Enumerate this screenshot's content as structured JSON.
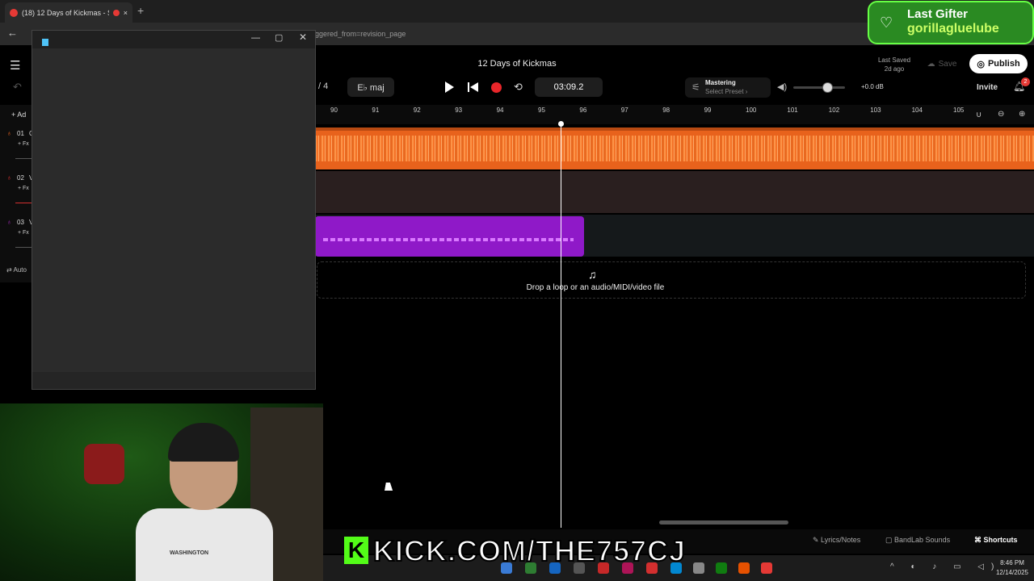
{
  "browser": {
    "tab_title": "(18) 12 Days of Kickmas - S",
    "tab_close": "×",
    "new_tab": "+",
    "back": "←",
    "url_fragment": "ggered_from=revision_page"
  },
  "header": {
    "menu_icon": "☰",
    "song_title": "12 Days of Kickmas",
    "last_saved_label": "Last Saved",
    "last_saved_value": "2d ago",
    "save_label": "Save",
    "publish_label": "Publish",
    "invite_label": "Invite",
    "notification_count": "2"
  },
  "transport": {
    "time_sig_fragment": "/ 4",
    "key": "E♭ maj",
    "time": "03:09.2",
    "loop_icon": "⟲"
  },
  "mastering": {
    "label": "Mastering",
    "preset": "Select Preset ›",
    "icon": "⚟"
  },
  "volume": {
    "db": "+0.0 dB",
    "level": 0.66
  },
  "gifter": {
    "title": "Last Gifter",
    "name": "gorillagluelube"
  },
  "tracks": {
    "add_label": "+ Ad",
    "items": [
      {
        "num": "01",
        "letter": "C",
        "fx": "+ Fx",
        "color": "#e8621c"
      },
      {
        "num": "02",
        "letter": "V",
        "fx": "+ Fx",
        "color": "#d32f2f"
      },
      {
        "num": "03",
        "letter": "V",
        "fx": "+ Fx",
        "color": "#9c27b0"
      }
    ],
    "automation_label": "Auto"
  },
  "ruler": {
    "ticks": [
      "90",
      "91",
      "92",
      "93",
      "94",
      "95",
      "96",
      "97",
      "98",
      "99",
      "100",
      "101",
      "102",
      "103",
      "104",
      "105"
    ]
  },
  "dropzone": {
    "text": "Drop a loop or an audio/MIDI/video file",
    "icon": "♫"
  },
  "bottom": {
    "lyrics": "Lyrics/Notes",
    "sounds": "BandLab Sounds",
    "shortcuts": "Shortcuts"
  },
  "stream": {
    "kick_logo": "K",
    "kick_url": "KICK.COM/THE757CJ",
    "shirt_text": "WASHINGTON"
  },
  "taskbar": {
    "time": "8:46 PM",
    "date": "12/14/2025",
    "tray": "^ ◐ ♪ ▭ ◁)"
  },
  "popup": {
    "minimize": "—",
    "maximize": "▢",
    "close": "✕"
  },
  "colors": {
    "accent_orange": "#e8621c",
    "clip_purple": "#8f19c8",
    "record_red": "#e8262a",
    "kick_green": "#53fc18"
  }
}
